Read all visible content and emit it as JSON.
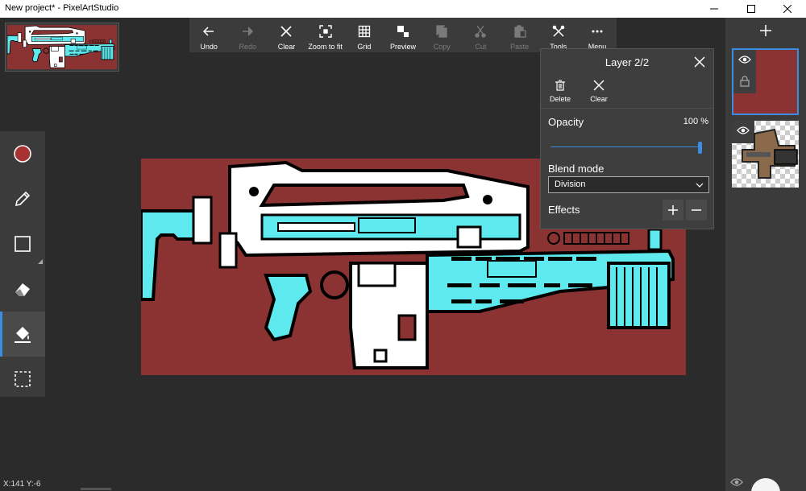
{
  "window": {
    "title": "New project* - PixelArtStudio"
  },
  "toolbar": {
    "items": [
      {
        "label": "Undo",
        "icon": "arrow-left-icon",
        "enabled": true
      },
      {
        "label": "Redo",
        "icon": "arrow-right-icon",
        "enabled": false
      },
      {
        "label": "Clear",
        "icon": "x-icon",
        "enabled": true
      },
      {
        "label": "Zoom to fit",
        "icon": "zoom-fit-icon",
        "enabled": true
      },
      {
        "label": "Grid",
        "icon": "grid-icon",
        "enabled": true
      },
      {
        "label": "Preview",
        "icon": "preview-icon",
        "enabled": true
      },
      {
        "label": "Copy",
        "icon": "copy-icon",
        "enabled": false
      },
      {
        "label": "Cut",
        "icon": "scissors-icon",
        "enabled": false
      },
      {
        "label": "Paste",
        "icon": "paste-icon",
        "enabled": false
      },
      {
        "label": "Tools",
        "icon": "tools-icon",
        "enabled": true
      },
      {
        "label": "Menu",
        "icon": "ellipsis-icon",
        "enabled": true
      }
    ]
  },
  "left_tools": {
    "items": [
      {
        "name": "color-swatch",
        "icon": "color-circle-icon"
      },
      {
        "name": "pencil",
        "icon": "pencil-icon"
      },
      {
        "name": "rectangle",
        "icon": "rectangle-icon"
      },
      {
        "name": "eraser",
        "icon": "eraser-icon"
      },
      {
        "name": "fill-bucket",
        "icon": "fill-bucket-icon",
        "active": true
      },
      {
        "name": "selection",
        "icon": "dashed-selection-icon"
      }
    ],
    "current_color": "#a83232"
  },
  "layer_panel": {
    "title": "Layer 2/2",
    "delete_label": "Delete",
    "clear_label": "Clear",
    "opacity_label": "Opacity",
    "opacity_value": "100 %",
    "opacity_fraction": 1.0,
    "blend_mode_label": "Blend mode",
    "blend_mode_value": "Division",
    "effects_label": "Effects"
  },
  "status": {
    "coordinates": "X:141 Y:-6"
  },
  "colors": {
    "canvas_background": "#8b3232",
    "gun_cyan": "#5ee9ee",
    "gun_white": "#ffffff",
    "accent": "#3a8de0"
  }
}
